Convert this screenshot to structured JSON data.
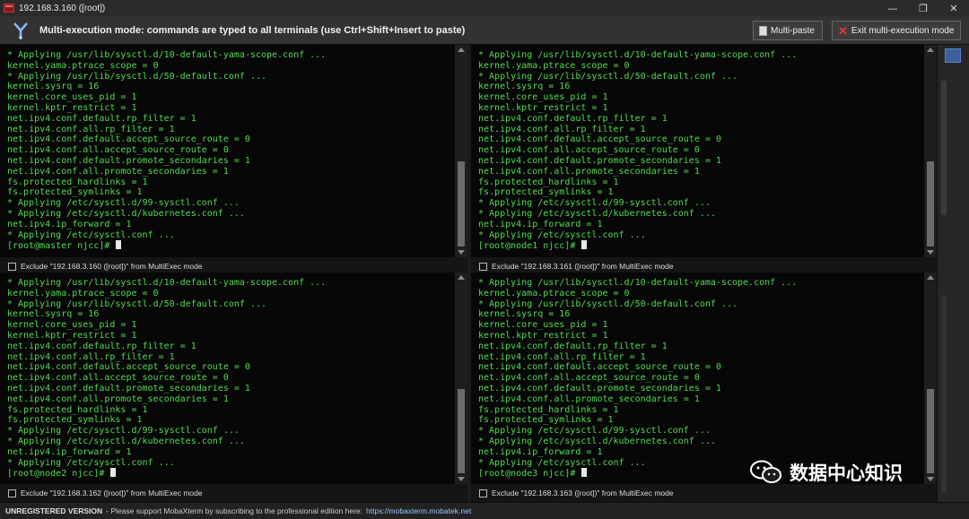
{
  "window": {
    "title": "192.168.3.160 ([root])",
    "minimize_glyph": "—",
    "restore_glyph": "❐",
    "close_glyph": "✕"
  },
  "banner": {
    "message": "Multi-execution mode: commands are typed to all terminals (use Ctrl+Shift+Insert to paste)",
    "multipaste_label": "Multi-paste",
    "exit_label": "Exit multi-execution mode",
    "icon": "multiexec-fork-icon"
  },
  "terminals": [
    {
      "host": "192.168.3.160",
      "lines": [
        "* Applying /usr/lib/sysctl.d/10-default-yama-scope.conf ...",
        "kernel.yama.ptrace_scope = 0",
        "* Applying /usr/lib/sysctl.d/50-default.conf ...",
        "kernel.sysrq = 16",
        "kernel.core_uses_pid = 1",
        "kernel.kptr_restrict = 1",
        "net.ipv4.conf.default.rp_filter = 1",
        "net.ipv4.conf.all.rp_filter = 1",
        "net.ipv4.conf.default.accept_source_route = 0",
        "net.ipv4.conf.all.accept_source_route = 0",
        "net.ipv4.conf.default.promote_secondaries = 1",
        "net.ipv4.conf.all.promote_secondaries = 1",
        "fs.protected_hardlinks = 1",
        "fs.protected_symlinks = 1",
        "* Applying /etc/sysctl.d/99-sysctl.conf ...",
        "* Applying /etc/sysctl.d/kubernetes.conf ...",
        "net.ipv4.ip_forward = 1",
        "* Applying /etc/sysctl.conf ..."
      ],
      "prompt": "[root@master njcc]# ",
      "exclude_label": "Exclude \"192.168.3.160 ([root])\" from MultiExec mode"
    },
    {
      "host": "192.168.3.161",
      "lines": [
        "* Applying /usr/lib/sysctl.d/10-default-yama-scope.conf ...",
        "kernel.yama.ptrace_scope = 0",
        "* Applying /usr/lib/sysctl.d/50-default.conf ...",
        "kernel.sysrq = 16",
        "kernel.core_uses_pid = 1",
        "kernel.kptr_restrict = 1",
        "net.ipv4.conf.default.rp_filter = 1",
        "net.ipv4.conf.all.rp_filter = 1",
        "net.ipv4.conf.default.accept_source_route = 0",
        "net.ipv4.conf.all.accept_source_route = 0",
        "net.ipv4.conf.default.promote_secondaries = 1",
        "net.ipv4.conf.all.promote_secondaries = 1",
        "fs.protected_hardlinks = 1",
        "fs.protected_symlinks = 1",
        "* Applying /etc/sysctl.d/99-sysctl.conf ...",
        "* Applying /etc/sysctl.d/kubernetes.conf ...",
        "net.ipv4.ip_forward = 1",
        "* Applying /etc/sysctl.conf ..."
      ],
      "prompt": "[root@node1 njcc]# ",
      "exclude_label": "Exclude \"192.168.3.161 ([root])\" from MultiExec mode"
    },
    {
      "host": "192.168.3.162",
      "lines": [
        "* Applying /usr/lib/sysctl.d/10-default-yama-scope.conf ...",
        "kernel.yama.ptrace_scope = 0",
        "* Applying /usr/lib/sysctl.d/50-default.conf ...",
        "kernel.sysrq = 16",
        "kernel.core_uses_pid = 1",
        "kernel.kptr_restrict = 1",
        "net.ipv4.conf.default.rp_filter = 1",
        "net.ipv4.conf.all.rp_filter = 1",
        "net.ipv4.conf.default.accept_source_route = 0",
        "net.ipv4.conf.all.accept_source_route = 0",
        "net.ipv4.conf.default.promote_secondaries = 1",
        "net.ipv4.conf.all.promote_secondaries = 1",
        "fs.protected_hardlinks = 1",
        "fs.protected_symlinks = 1",
        "* Applying /etc/sysctl.d/99-sysctl.conf ...",
        "* Applying /etc/sysctl.d/kubernetes.conf ...",
        "net.ipv4.ip_forward = 1",
        "* Applying /etc/sysctl.conf ..."
      ],
      "prompt": "[root@node2 njcc]# ",
      "exclude_label": "Exclude \"192.168.3.162 ([root])\" from MultiExec mode"
    },
    {
      "host": "192.168.3.163",
      "lines": [
        "* Applying /usr/lib/sysctl.d/10-default-yama-scope.conf ...",
        "kernel.yama.ptrace_scope = 0",
        "* Applying /usr/lib/sysctl.d/50-default.conf ...",
        "kernel.sysrq = 16",
        "kernel.core_uses_pid = 1",
        "kernel.kptr_restrict = 1",
        "net.ipv4.conf.default.rp_filter = 1",
        "net.ipv4.conf.all.rp_filter = 1",
        "net.ipv4.conf.default.accept_source_route = 0",
        "net.ipv4.conf.all.accept_source_route = 0",
        "net.ipv4.conf.default.promote_secondaries = 1",
        "net.ipv4.conf.all.promote_secondaries = 1",
        "fs.protected_hardlinks = 1",
        "fs.protected_symlinks = 1",
        "* Applying /etc/sysctl.d/99-sysctl.conf ...",
        "* Applying /etc/sysctl.d/kubernetes.conf ...",
        "net.ipv4.ip_forward = 1",
        "* Applying /etc/sysctl.conf ..."
      ],
      "prompt": "[root@node3 njcc]# ",
      "exclude_label": "Exclude \"192.168.3.163 ([root])\" from MultiExec mode"
    }
  ],
  "statusbar": {
    "edition": "UNREGISTERED VERSION",
    "message": "-  Please support MobaXterm by subscribing to the professional edition here:",
    "link": "https://mobaxterm.mobatek.net"
  },
  "watermark": {
    "text": "数据中心知识"
  },
  "colors": {
    "terminal_text": "#4fdc4f",
    "terminal_bg": "#070707",
    "chrome_bg": "#323232"
  }
}
